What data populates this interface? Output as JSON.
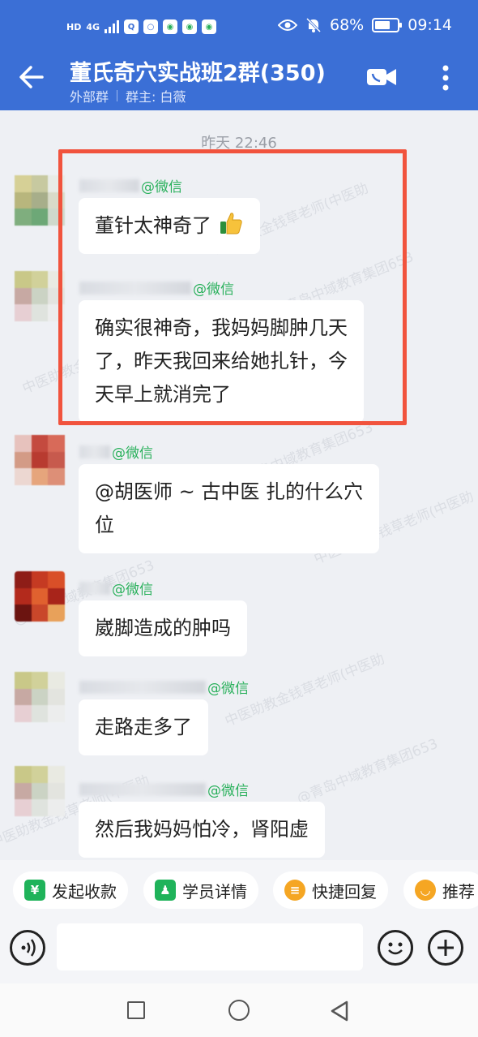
{
  "status_bar": {
    "hd": "HD",
    "network": "4G",
    "battery": "68%",
    "battery_level": 0.68,
    "time": "09:14",
    "icons": [
      "signal-icon",
      "search-app-icon",
      "bulb-app-icon",
      "mobile-app-icon",
      "mobile-app-icon",
      "mobile-app-icon",
      "eye-icon",
      "mute-bell-icon",
      "battery-icon"
    ]
  },
  "header": {
    "title": "董氏奇穴实战班2群(350)",
    "tag": "外部群",
    "owner": "群主: 白薇",
    "icons": [
      "back-arrow-icon",
      "video-call-icon",
      "more-vertical-icon"
    ]
  },
  "chat": {
    "timestamp": "昨天  22:46",
    "watermark": [
      "中医助教金钱草老师(中医助",
      "@青岛中域教育集团653"
    ],
    "messages": [
      {
        "source": "@微信",
        "text": "董针太神奇了",
        "emoji": "thumbs-up-icon"
      },
      {
        "source": "@微信",
        "text": "确实很神奇，我妈妈脚肿几天了，昨天我回来给她扎针，今天早上就消完了",
        "lines": [
          "确实很神奇，我妈妈脚肿几天",
          "了，昨天我回来给她扎针，今",
          "天早上就消完了"
        ]
      },
      {
        "source": "@微信",
        "lines": [
          "@胡医师 ~ 古中医 扎的什么穴",
          "位"
        ]
      },
      {
        "source": "@微信",
        "text": "崴脚造成的肿吗"
      },
      {
        "source": "@微信",
        "text": "走路走多了"
      },
      {
        "source": "@微信",
        "text": "然后我妈妈怕冷，肾阳虚"
      }
    ]
  },
  "quick_actions": [
    {
      "label": "发起收款",
      "icon": "payment-icon",
      "color": "#1fb35a"
    },
    {
      "label": "学员详情",
      "icon": "student-icon",
      "color": "#1fb35a"
    },
    {
      "label": "快捷回复",
      "icon": "quick-reply-icon",
      "color": "#f5a623"
    },
    {
      "label": "推荐",
      "icon": "recommend-icon",
      "color": "#f5a623"
    }
  ],
  "input": {
    "placeholder": "",
    "icons": [
      "voice-icon",
      "emoji-icon",
      "plus-icon"
    ]
  },
  "nav": {
    "icons": [
      "recent-apps-icon",
      "home-icon",
      "back-icon"
    ]
  },
  "colors": {
    "header": "#3b6fd6",
    "highlight": "#f1533d",
    "wechat": "#29b05b"
  }
}
